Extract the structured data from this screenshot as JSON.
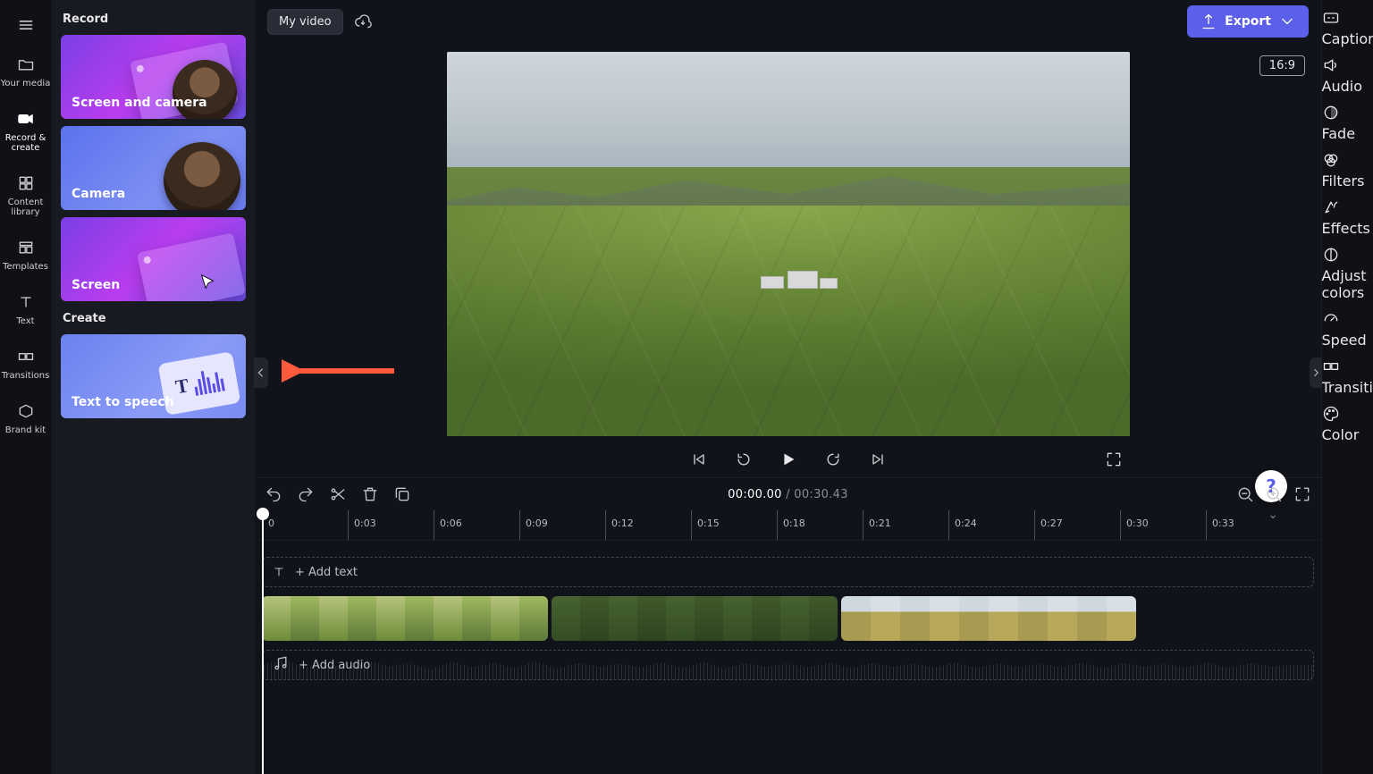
{
  "topbar": {
    "project_name": "My video",
    "export_label": "Export"
  },
  "aspect_ratio": "16:9",
  "left_rail": {
    "items": [
      {
        "label": "Your media"
      },
      {
        "label": "Record & create"
      },
      {
        "label": "Content library"
      },
      {
        "label": "Templates"
      },
      {
        "label": "Text"
      },
      {
        "label": "Transitions"
      },
      {
        "label": "Brand kit"
      }
    ]
  },
  "panel": {
    "section_record": "Record",
    "section_create": "Create",
    "cards": {
      "screen_camera": "Screen and camera",
      "camera": "Camera",
      "screen": "Screen",
      "tts": "Text to speech"
    }
  },
  "transport": {
    "current": "00:00.00",
    "duration": "00:30.43"
  },
  "timeline": {
    "ticks": [
      "0",
      "0:03",
      "0:06",
      "0:09",
      "0:12",
      "0:15",
      "0:18",
      "0:21",
      "0:24",
      "0:27",
      "0:30",
      "0:33"
    ],
    "add_text": "+ Add text",
    "add_audio": "+ Add audio"
  },
  "right_rail": {
    "items": [
      {
        "label": "Captions"
      },
      {
        "label": "Audio"
      },
      {
        "label": "Fade"
      },
      {
        "label": "Filters"
      },
      {
        "label": "Effects"
      },
      {
        "label": "Adjust colors"
      },
      {
        "label": "Speed"
      },
      {
        "label": "Transition"
      },
      {
        "label": "Color"
      }
    ]
  },
  "help": "?"
}
